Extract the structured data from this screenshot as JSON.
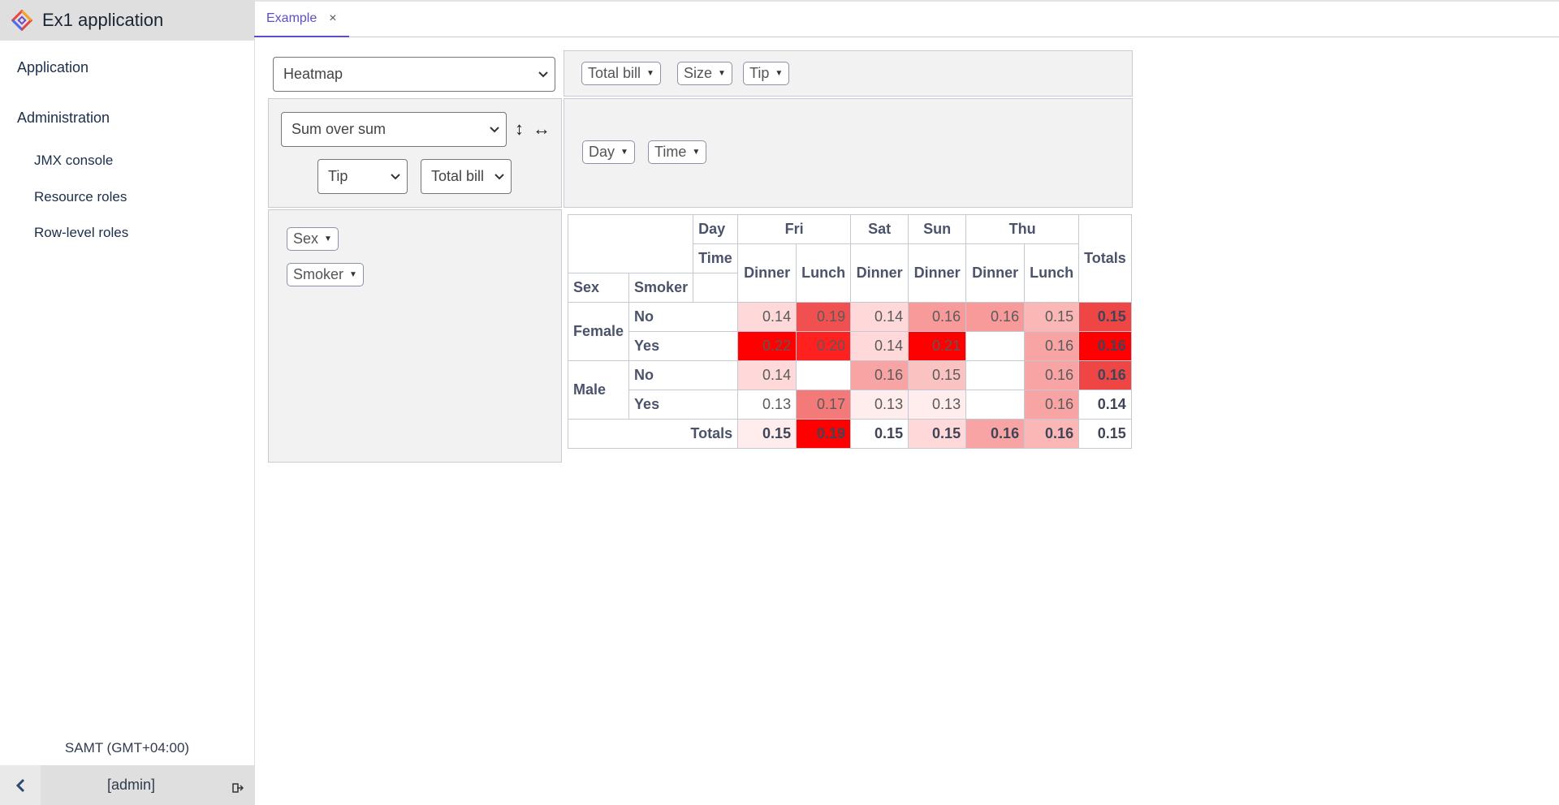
{
  "app": {
    "title": "Ex1 application"
  },
  "sidebar": {
    "groups": [
      {
        "label": "Application"
      },
      {
        "label": "Administration",
        "items": [
          {
            "label": "JMX console"
          },
          {
            "label": "Resource roles"
          },
          {
            "label": "Row-level roles"
          }
        ]
      }
    ],
    "timezone": "SAMT (GMT+04:00)",
    "user": "[admin]"
  },
  "tabs": [
    {
      "label": "Example",
      "close": "×"
    }
  ],
  "pivot": {
    "renderer": "Heatmap",
    "aggregator": "Sum over sum",
    "agg_arg1": "Tip",
    "agg_arg2": "Total bill",
    "sort_rows_icon": "↕",
    "sort_cols_icon": "↔",
    "unused_fields": [
      "Total bill",
      "Size",
      "Tip"
    ],
    "col_fields": [
      "Day",
      "Time"
    ],
    "row_fields": [
      "Sex",
      "Smoker"
    ],
    "table": {
      "col_attr_labels": [
        "Day",
        "Time"
      ],
      "row_attr_labels": [
        "Sex",
        "Smoker"
      ],
      "days": [
        "Fri",
        "Sat",
        "Sun",
        "Thu"
      ],
      "times": [
        "Dinner",
        "Lunch",
        "Dinner",
        "Dinner",
        "Dinner",
        "Lunch"
      ],
      "totals_label": "Totals",
      "sexes": [
        "Female",
        "Male"
      ],
      "smokers": [
        "No",
        "Yes",
        "No",
        "Yes"
      ],
      "rows": [
        {
          "cells": [
            "0.14",
            "0.19",
            "0.14",
            "0.16",
            "0.16",
            "0.15"
          ],
          "total": "0.15"
        },
        {
          "cells": [
            "0.22",
            "0.20",
            "0.14",
            "0.21",
            "",
            "0.16"
          ],
          "total": "0.16"
        },
        {
          "cells": [
            "0.14",
            "",
            "0.16",
            "0.15",
            "",
            "0.16"
          ],
          "total": "0.16"
        },
        {
          "cells": [
            "0.13",
            "0.17",
            "0.13",
            "0.13",
            "",
            "0.16"
          ],
          "total": "0.14"
        }
      ],
      "col_totals": [
        "0.15",
        "0.19",
        "0.15",
        "0.15",
        "0.16",
        "0.16"
      ],
      "grand_total": "0.15"
    },
    "heat_colors": {
      "r0c0": "#ffd9d9",
      "r0c1": "#f15050",
      "r0c2": "#ffd9d9",
      "r0c3": "#f99a9a",
      "r0c4": "#f99a9a",
      "r0c5": "#fbb6b6",
      "r0t": "#ee4545",
      "r1c0": "#ff0000",
      "r1c1": "#ff2020",
      "r1c2": "#ffd9d9",
      "r1c3": "#ff0000",
      "r1c4": "#ffffff",
      "r1c5": "#f9a4a4",
      "r1t": "#ff0000",
      "r2c0": "#ffd9d9",
      "r2c1": "#ffffff",
      "r2c2": "#f9a4a4",
      "r2c3": "#fbc2c2",
      "r2c4": "#ffffff",
      "r2c5": "#f9a4a4",
      "r2t": "#ee4545",
      "r3c0": "#ffffff",
      "r3c1": "#f47a7a",
      "r3c2": "#ffecec",
      "r3c3": "#ffecec",
      "r3c4": "#ffffff",
      "r3c5": "#f9a4a4",
      "r3t": "#ffffff",
      "tc0": "#ffecec",
      "tc1": "#ff0000",
      "tc2": "#ffffff",
      "tc3": "#ffd9d9",
      "tc4": "#f9a4a4",
      "tc5": "#fbb6b6",
      "gt": "#ffffff"
    }
  }
}
